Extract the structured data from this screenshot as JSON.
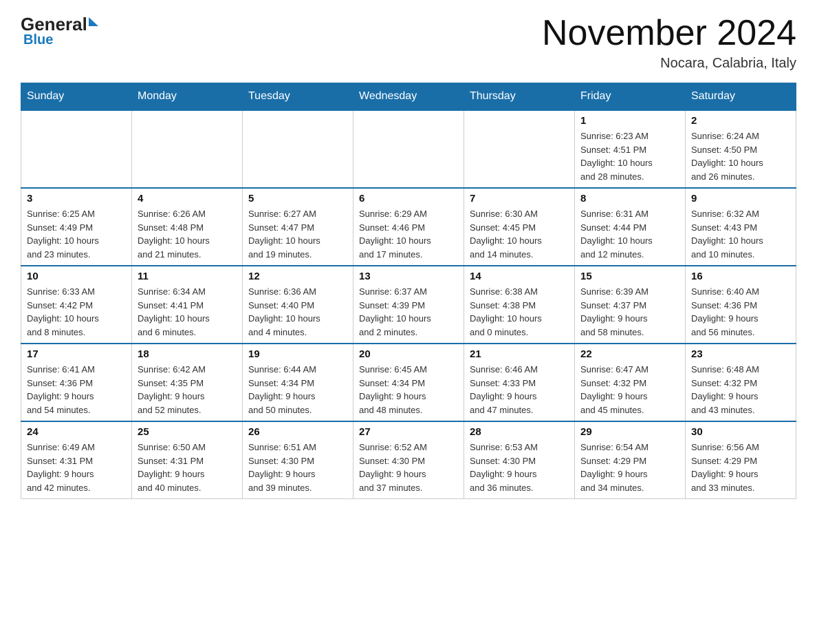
{
  "header": {
    "logo_general": "General",
    "logo_blue": "Blue",
    "month_year": "November 2024",
    "location": "Nocara, Calabria, Italy"
  },
  "weekdays": [
    "Sunday",
    "Monday",
    "Tuesday",
    "Wednesday",
    "Thursday",
    "Friday",
    "Saturday"
  ],
  "weeks": [
    {
      "days": [
        {
          "num": "",
          "info": ""
        },
        {
          "num": "",
          "info": ""
        },
        {
          "num": "",
          "info": ""
        },
        {
          "num": "",
          "info": ""
        },
        {
          "num": "",
          "info": ""
        },
        {
          "num": "1",
          "info": "Sunrise: 6:23 AM\nSunset: 4:51 PM\nDaylight: 10 hours\nand 28 minutes."
        },
        {
          "num": "2",
          "info": "Sunrise: 6:24 AM\nSunset: 4:50 PM\nDaylight: 10 hours\nand 26 minutes."
        }
      ]
    },
    {
      "days": [
        {
          "num": "3",
          "info": "Sunrise: 6:25 AM\nSunset: 4:49 PM\nDaylight: 10 hours\nand 23 minutes."
        },
        {
          "num": "4",
          "info": "Sunrise: 6:26 AM\nSunset: 4:48 PM\nDaylight: 10 hours\nand 21 minutes."
        },
        {
          "num": "5",
          "info": "Sunrise: 6:27 AM\nSunset: 4:47 PM\nDaylight: 10 hours\nand 19 minutes."
        },
        {
          "num": "6",
          "info": "Sunrise: 6:29 AM\nSunset: 4:46 PM\nDaylight: 10 hours\nand 17 minutes."
        },
        {
          "num": "7",
          "info": "Sunrise: 6:30 AM\nSunset: 4:45 PM\nDaylight: 10 hours\nand 14 minutes."
        },
        {
          "num": "8",
          "info": "Sunrise: 6:31 AM\nSunset: 4:44 PM\nDaylight: 10 hours\nand 12 minutes."
        },
        {
          "num": "9",
          "info": "Sunrise: 6:32 AM\nSunset: 4:43 PM\nDaylight: 10 hours\nand 10 minutes."
        }
      ]
    },
    {
      "days": [
        {
          "num": "10",
          "info": "Sunrise: 6:33 AM\nSunset: 4:42 PM\nDaylight: 10 hours\nand 8 minutes."
        },
        {
          "num": "11",
          "info": "Sunrise: 6:34 AM\nSunset: 4:41 PM\nDaylight: 10 hours\nand 6 minutes."
        },
        {
          "num": "12",
          "info": "Sunrise: 6:36 AM\nSunset: 4:40 PM\nDaylight: 10 hours\nand 4 minutes."
        },
        {
          "num": "13",
          "info": "Sunrise: 6:37 AM\nSunset: 4:39 PM\nDaylight: 10 hours\nand 2 minutes."
        },
        {
          "num": "14",
          "info": "Sunrise: 6:38 AM\nSunset: 4:38 PM\nDaylight: 10 hours\nand 0 minutes."
        },
        {
          "num": "15",
          "info": "Sunrise: 6:39 AM\nSunset: 4:37 PM\nDaylight: 9 hours\nand 58 minutes."
        },
        {
          "num": "16",
          "info": "Sunrise: 6:40 AM\nSunset: 4:36 PM\nDaylight: 9 hours\nand 56 minutes."
        }
      ]
    },
    {
      "days": [
        {
          "num": "17",
          "info": "Sunrise: 6:41 AM\nSunset: 4:36 PM\nDaylight: 9 hours\nand 54 minutes."
        },
        {
          "num": "18",
          "info": "Sunrise: 6:42 AM\nSunset: 4:35 PM\nDaylight: 9 hours\nand 52 minutes."
        },
        {
          "num": "19",
          "info": "Sunrise: 6:44 AM\nSunset: 4:34 PM\nDaylight: 9 hours\nand 50 minutes."
        },
        {
          "num": "20",
          "info": "Sunrise: 6:45 AM\nSunset: 4:34 PM\nDaylight: 9 hours\nand 48 minutes."
        },
        {
          "num": "21",
          "info": "Sunrise: 6:46 AM\nSunset: 4:33 PM\nDaylight: 9 hours\nand 47 minutes."
        },
        {
          "num": "22",
          "info": "Sunrise: 6:47 AM\nSunset: 4:32 PM\nDaylight: 9 hours\nand 45 minutes."
        },
        {
          "num": "23",
          "info": "Sunrise: 6:48 AM\nSunset: 4:32 PM\nDaylight: 9 hours\nand 43 minutes."
        }
      ]
    },
    {
      "days": [
        {
          "num": "24",
          "info": "Sunrise: 6:49 AM\nSunset: 4:31 PM\nDaylight: 9 hours\nand 42 minutes."
        },
        {
          "num": "25",
          "info": "Sunrise: 6:50 AM\nSunset: 4:31 PM\nDaylight: 9 hours\nand 40 minutes."
        },
        {
          "num": "26",
          "info": "Sunrise: 6:51 AM\nSunset: 4:30 PM\nDaylight: 9 hours\nand 39 minutes."
        },
        {
          "num": "27",
          "info": "Sunrise: 6:52 AM\nSunset: 4:30 PM\nDaylight: 9 hours\nand 37 minutes."
        },
        {
          "num": "28",
          "info": "Sunrise: 6:53 AM\nSunset: 4:30 PM\nDaylight: 9 hours\nand 36 minutes."
        },
        {
          "num": "29",
          "info": "Sunrise: 6:54 AM\nSunset: 4:29 PM\nDaylight: 9 hours\nand 34 minutes."
        },
        {
          "num": "30",
          "info": "Sunrise: 6:56 AM\nSunset: 4:29 PM\nDaylight: 9 hours\nand 33 minutes."
        }
      ]
    }
  ]
}
